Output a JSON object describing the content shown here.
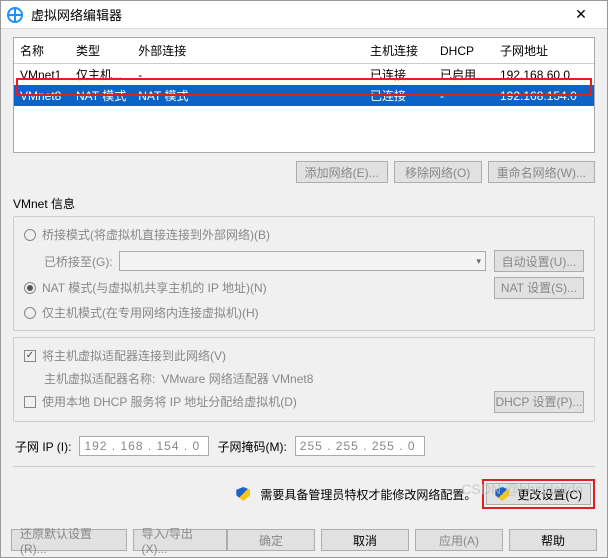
{
  "title": "虚拟网络编辑器",
  "table": {
    "headers": [
      "名称",
      "类型",
      "外部连接",
      "主机连接",
      "DHCP",
      "子网地址"
    ],
    "rows": [
      {
        "name": "VMnet1",
        "type": "仅主机...",
        "ext": "-",
        "host": "已连接",
        "dhcp": "已启用",
        "subnet": "192.168.60.0"
      },
      {
        "name": "VMnet8",
        "type": "NAT 模式",
        "ext": "NAT 模式",
        "host": "已连接",
        "dhcp": "-",
        "subnet": "192.168.154.0"
      }
    ]
  },
  "buttons": {
    "add_net": "添加网络(E)...",
    "remove_net": "移除网络(O)",
    "rename_net": "重命名网络(W)..."
  },
  "info_label": "VMnet 信息",
  "mode_bridge": "桥接模式(将虚拟机直接连接到外部网络)(B)",
  "bridge_to_label": "已桥接至(G):",
  "bridge_auto_btn": "自动设置(U)...",
  "mode_nat": "NAT 模式(与虚拟机共享主机的 IP 地址)(N)",
  "nat_btn": "NAT 设置(S)...",
  "mode_host": "仅主机模式(在专用网络内连接虚拟机)(H)",
  "connect_adapter": "将主机虚拟适配器连接到此网络(V)",
  "adapter_name_label": "主机虚拟适配器名称: ",
  "adapter_name_value": "VMware 网络适配器 VMnet8",
  "use_dhcp": "使用本地 DHCP 服务将 IP 地址分配给虚拟机(D)",
  "dhcp_btn": "DHCP 设置(P)...",
  "subnet_ip_label": "子网 IP (I):",
  "subnet_ip_value": "192 . 168 . 154 .  0",
  "subnet_mask_label": "子网掩码(M):",
  "subnet_mask_value": "255 . 255 . 255 .  0",
  "notice": "需要具备管理员特权才能修改网络配置。",
  "change_settings": "更改设置(C)",
  "restore_defaults": "还原默认设置(R)...",
  "import_export": "导入/导出(X)...",
  "ok": "确定",
  "cancel": "取消",
  "apply": "应用(A)",
  "help": "帮助",
  "watermark": "CSDN @hhzfdelidn"
}
